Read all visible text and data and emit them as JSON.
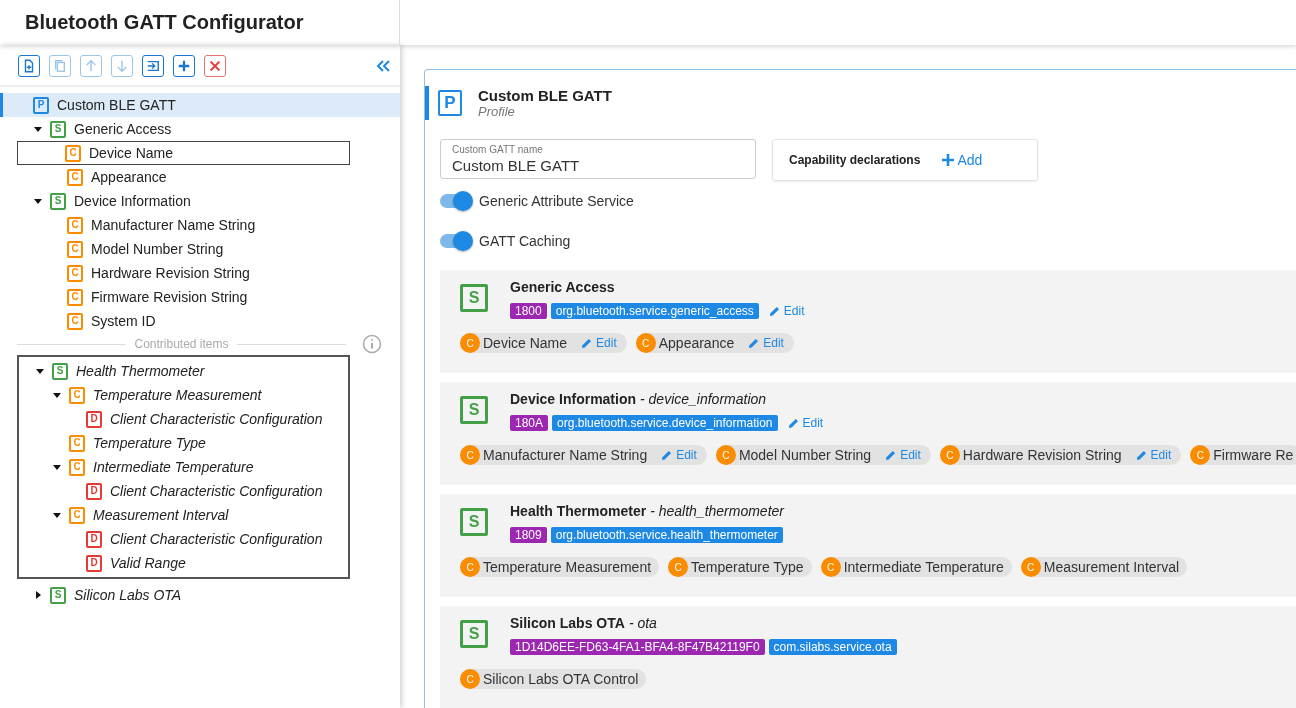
{
  "app_title": "Bluetooth GATT Configurator",
  "toolbar": [
    {
      "kind": "new",
      "disabled": false
    },
    {
      "kind": "copy",
      "disabled": true
    },
    {
      "kind": "up",
      "disabled": true
    },
    {
      "kind": "down",
      "disabled": true
    },
    {
      "kind": "import",
      "disabled": false
    },
    {
      "kind": "add",
      "disabled": false
    },
    {
      "kind": "delete",
      "disabled": false
    }
  ],
  "tree": [
    {
      "kind": "profile",
      "badge": "P",
      "label": "Custom BLE GATT",
      "selected": true,
      "focused": false,
      "children": [
        {
          "kind": "service",
          "badge": "S",
          "label": "Generic Access",
          "selected": false,
          "focused": false,
          "expanded": true,
          "children": [
            {
              "kind": "characteristic",
              "badge": "C",
              "label": "Device Name",
              "selected": false,
              "focused": true
            },
            {
              "kind": "characteristic",
              "badge": "C",
              "label": "Appearance",
              "selected": false,
              "focused": false
            }
          ]
        },
        {
          "kind": "service",
          "badge": "S",
          "label": "Device Information",
          "selected": false,
          "focused": false,
          "expanded": true,
          "children": [
            {
              "kind": "characteristic",
              "badge": "C",
              "label": "Manufacturer Name String",
              "selected": false,
              "focused": false
            },
            {
              "kind": "characteristic",
              "badge": "C",
              "label": "Model Number String",
              "selected": false,
              "focused": false
            },
            {
              "kind": "characteristic",
              "badge": "C",
              "label": "Hardware Revision String",
              "selected": false,
              "focused": false
            },
            {
              "kind": "characteristic",
              "badge": "C",
              "label": "Firmware Revision String",
              "selected": false,
              "focused": false
            },
            {
              "kind": "characteristic",
              "badge": "C",
              "label": "System ID",
              "selected": false,
              "focused": false
            }
          ]
        }
      ]
    }
  ],
  "contributed": {
    "heading": "Contributed items",
    "boxed": [
      {
        "kind": "service",
        "badge": "S",
        "label": "Health Thermometer",
        "selected": false,
        "focused": false,
        "expanded": true,
        "children": [
          {
            "kind": "characteristic",
            "badge": "C",
            "label": "Temperature Measurement",
            "selected": false,
            "focused": false,
            "expanded": true,
            "children": [
              {
                "kind": "descriptor",
                "badge": "D",
                "label": "Client Characteristic Configuration",
                "selected": false,
                "focused": false
              }
            ]
          },
          {
            "kind": "characteristic",
            "badge": "C",
            "label": "Temperature Type",
            "selected": false,
            "focused": false
          },
          {
            "kind": "characteristic",
            "badge": "C",
            "label": "Intermediate Temperature",
            "selected": false,
            "focused": false,
            "expanded": true,
            "children": [
              {
                "kind": "descriptor",
                "badge": "D",
                "label": "Client Characteristic Configuration",
                "selected": false,
                "focused": false
              }
            ]
          },
          {
            "kind": "characteristic",
            "badge": "C",
            "label": "Measurement Interval",
            "selected": false,
            "focused": false,
            "expanded": true,
            "children": [
              {
                "kind": "descriptor",
                "badge": "D",
                "label": "Client Characteristic Configuration",
                "selected": false,
                "focused": false
              },
              {
                "kind": "descriptor",
                "badge": "D",
                "label": "Valid Range",
                "selected": false,
                "focused": false
              }
            ]
          }
        ]
      }
    ],
    "others": [
      {
        "kind": "service",
        "badge": "S",
        "label": "Silicon Labs OTA",
        "selected": false,
        "focused": false,
        "expanded": false
      }
    ]
  },
  "profile": {
    "badge": "P",
    "name": "Custom BLE GATT",
    "type": "Profile"
  },
  "name_field": {
    "label": "Custom GATT name",
    "value": "Custom BLE GATT"
  },
  "capability": {
    "label": "Capability declarations",
    "add": "Add"
  },
  "toggles": [
    {
      "label": "Generic Attribute Service",
      "on": true
    },
    {
      "label": "GATT Caching",
      "on": true
    }
  ],
  "services": [
    {
      "badge": "S",
      "name": "Generic Access",
      "uuid": "1800",
      "identifier": "org.bluetooth.service.generic_access",
      "edit": "Edit",
      "characteristics": [
        {
          "badge": "C",
          "name": "Device Name",
          "edit": "Edit"
        },
        {
          "badge": "C",
          "name": "Appearance",
          "edit": "Edit"
        }
      ]
    },
    {
      "badge": "S",
      "name": "Device Information",
      "id": "- device_information",
      "uuid": "180A",
      "identifier": "org.bluetooth.service.device_information",
      "edit": "Edit",
      "characteristics": [
        {
          "badge": "C",
          "name": "Manufacturer Name String",
          "edit": "Edit"
        },
        {
          "badge": "C",
          "name": "Model Number String",
          "edit": "Edit"
        },
        {
          "badge": "C",
          "name": "Hardware Revision String",
          "edit": "Edit"
        },
        {
          "badge": "C",
          "name": "Firmware Re"
        }
      ]
    },
    {
      "badge": "S",
      "name": "Health Thermometer",
      "id": "- health_thermometer",
      "uuid": "1809",
      "identifier": "org.bluetooth.service.health_thermometer",
      "characteristics": [
        {
          "badge": "C",
          "name": "Temperature Measurement"
        },
        {
          "badge": "C",
          "name": "Temperature Type"
        },
        {
          "badge": "C",
          "name": "Intermediate Temperature"
        },
        {
          "badge": "C",
          "name": "Measurement Interval"
        }
      ]
    },
    {
      "badge": "S",
      "name": "Silicon Labs OTA",
      "id": "- ota",
      "uuid": "1D14D6EE-FD63-4FA1-BFA4-8F47B42119F0",
      "identifier": "com.silabs.service.ota",
      "characteristics": [
        {
          "badge": "C",
          "name": "Silicon Labs OTA Control"
        }
      ]
    }
  ]
}
